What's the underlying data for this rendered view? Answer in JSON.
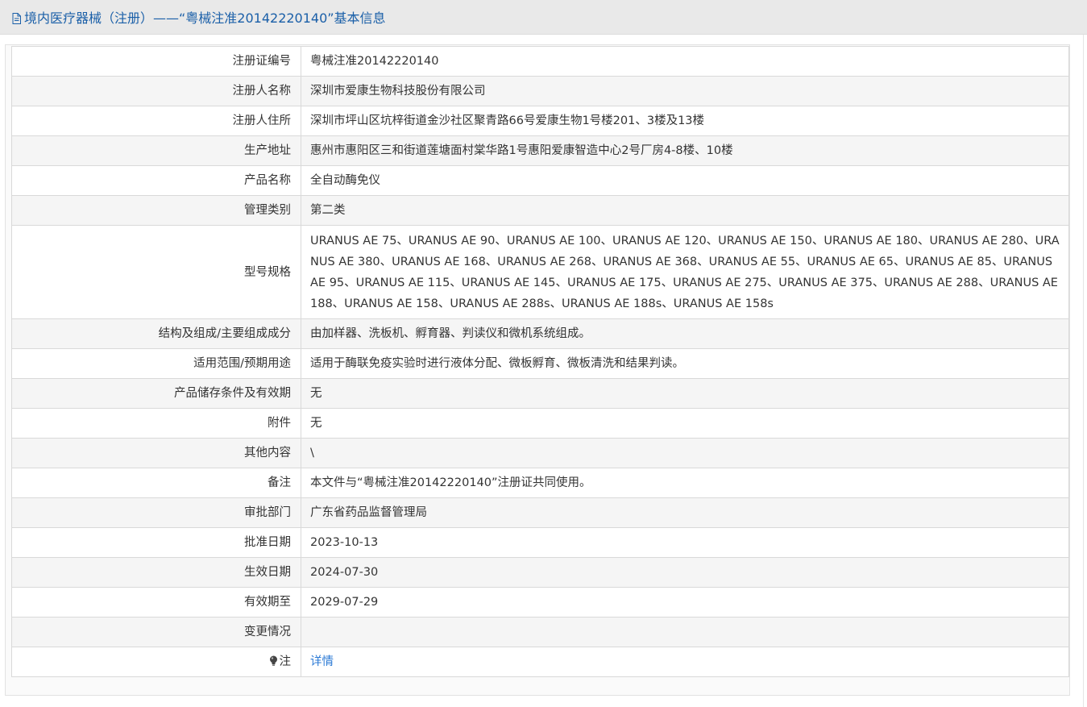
{
  "header": {
    "title": "境内医疗器械（注册）——“粤械注准20142220140”基本信息",
    "icon": "document-icon",
    "accent_color": "#1a5fa8",
    "background": "#e9e9e9"
  },
  "rows": [
    {
      "label": "注册证编号",
      "value": "粤械注准20142220140"
    },
    {
      "label": "注册人名称",
      "value": "深圳市爱康生物科技股份有限公司"
    },
    {
      "label": "注册人住所",
      "value": "深圳市坪山区坑梓街道金沙社区聚青路66号爱康生物1号楼201、3楼及13楼"
    },
    {
      "label": "生产地址",
      "value": "惠州市惠阳区三和街道莲塘面村棠华路1号惠阳爱康智造中心2号厂房4-8楼、10楼"
    },
    {
      "label": "产品名称",
      "value": "全自动酶免仪"
    },
    {
      "label": "管理类别",
      "value": "第二类"
    },
    {
      "label": "型号规格",
      "value": "URANUS AE 75、URANUS AE 90、URANUS AE 100、URANUS AE 120、URANUS AE 150、URANUS AE 180、URANUS AE 280、URANUS AE 380、URANUS AE 168、URANUS AE 268、URANUS AE 368、URANUS AE 55、URANUS AE 65、URANUS AE 85、URANUS AE 95、URANUS AE 115、URANUS AE 145、URANUS AE 175、URANUS AE 275、URANUS AE 375、URANUS AE 288、URANUS AE 188、URANUS AE 158、URANUS AE 288s、URANUS AE 188s、URANUS AE 158s"
    },
    {
      "label": "结构及组成/主要组成成分",
      "value": "由加样器、洗板机、孵育器、判读仪和微机系统组成。"
    },
    {
      "label": "适用范围/预期用途",
      "value": "适用于酶联免疫实验时进行液体分配、微板孵育、微板清洗和结果判读。"
    },
    {
      "label": "产品储存条件及有效期",
      "value": "无"
    },
    {
      "label": "附件",
      "value": "无"
    },
    {
      "label": "其他内容",
      "value": "\\"
    },
    {
      "label": "备注",
      "value": "本文件与“粤械注准20142220140”注册证共同使用。"
    },
    {
      "label": "审批部门",
      "value": "广东省药品监督管理局"
    },
    {
      "label": "批准日期",
      "value": "2023-10-13"
    },
    {
      "label": "生效日期",
      "value": "2024-07-30"
    },
    {
      "label": "有效期至",
      "value": "2029-07-29"
    },
    {
      "label": "变更情况",
      "value": ""
    }
  ],
  "note_row": {
    "label": "注",
    "icon": "lightbulb-icon",
    "link_text": "详情",
    "link_color": "#2d7bd6"
  }
}
